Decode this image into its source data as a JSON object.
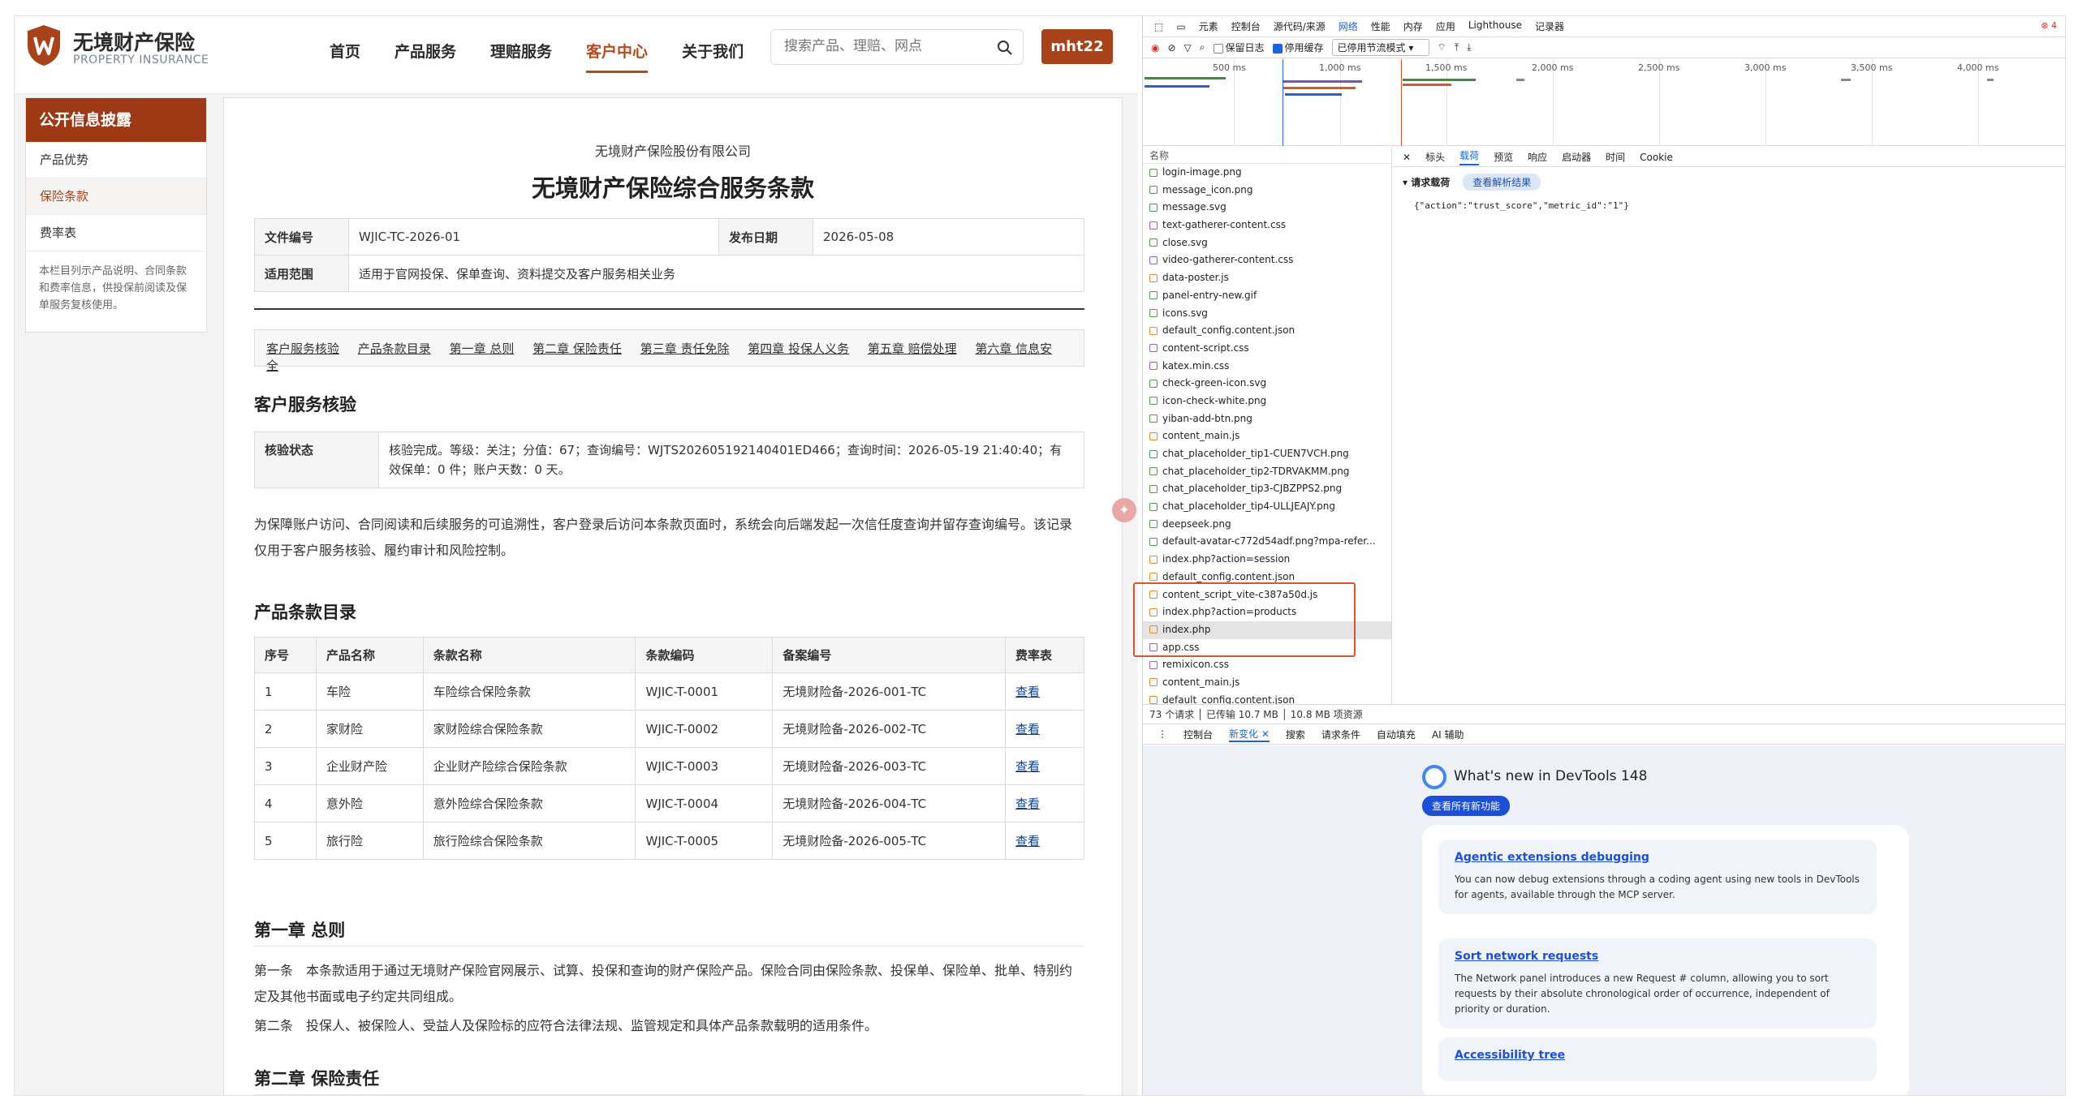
{
  "site": {
    "brand_cn": "无境财产保险",
    "brand_en": "PROPERTY INSURANCE",
    "nav": [
      "首页",
      "产品服务",
      "理赔服务",
      "客户中心",
      "关于我们"
    ],
    "active_nav_index": 3,
    "search_placeholder": "搜索产品、理赔、网点",
    "user_label": "mht22",
    "sidebar": {
      "title": "公开信息披露",
      "items": [
        "产品优势",
        "保险条款",
        "费率表"
      ],
      "active_item_index": 1,
      "note": "本栏目列示产品说明、合同条款和费率信息，供投保前阅读及保单服务复核使用。"
    },
    "doc": {
      "company": "无境财产保险股份有限公司",
      "title": "无境财产保险综合服务条款",
      "meta": {
        "doc_no_label": "文件编号",
        "doc_no": "WJIC-TC-2026-01",
        "date_label": "发布日期",
        "date": "2026-05-08",
        "scope_label": "适用范围",
        "scope": "适用于官网投保、保单查询、资料提交及客户服务相关业务"
      },
      "toc": [
        "客户服务核验",
        "产品条款目录",
        "第一章 总则",
        "第二章 保险责任",
        "第三章 责任免除",
        "第四章 投保人义务",
        "第五章 赔偿处理",
        "第六章 信息安全"
      ],
      "verify_heading": "客户服务核验",
      "verify_label": "核验状态",
      "verify_text": "核验完成。等级：关注；分值：67；查询编号：WJTS202605192140401ED466；查询时间：2026-05-19 21:40:40；有效保单：0 件；账户天数：0 天。",
      "verify_para": "为保障账户访问、合同阅读和后续服务的可追溯性，客户登录后访问本条款页面时，系统会向后端发起一次信任度查询并留存查询编号。该记录仅用于客户服务核验、履约审计和风险控制。",
      "catalog_heading": "产品条款目录",
      "catalog_columns": [
        "序号",
        "产品名称",
        "条款名称",
        "条款编码",
        "备案编号",
        "费率表"
      ],
      "catalog_rows": [
        [
          "1",
          "车险",
          "车险综合保险条款",
          "WJIC-T-0001",
          "无境财险备-2026-001-TC",
          "查看"
        ],
        [
          "2",
          "家财险",
          "家财险综合保险条款",
          "WJIC-T-0002",
          "无境财险备-2026-002-TC",
          "查看"
        ],
        [
          "3",
          "企业财产险",
          "企业财产险综合保险条款",
          "WJIC-T-0003",
          "无境财险备-2026-003-TC",
          "查看"
        ],
        [
          "4",
          "意外险",
          "意外险综合保险条款",
          "WJIC-T-0004",
          "无境财险备-2026-004-TC",
          "查看"
        ],
        [
          "5",
          "旅行险",
          "旅行险综合保险条款",
          "WJIC-T-0005",
          "无境财险备-2026-005-TC",
          "查看"
        ]
      ],
      "ch1_heading": "第一章 总则",
      "ch1_art1": "第一条　本条款适用于通过无境财产保险官网展示、试算、投保和查询的财产保险产品。保险合同由保险条款、投保单、保险单、批单、特别约定及其他书面或电子约定共同组成。",
      "ch1_art2": "第二条　投保人、被保险人、受益人及保险标的应符合法律法规、监管规定和具体产品条款载明的适用条件。",
      "ch2_heading": "第二章 保险责任"
    }
  },
  "devtools": {
    "tabs": [
      "元素",
      "控制台",
      "源代码/来源",
      "网络",
      "性能",
      "内存",
      "应用",
      "Lighthouse",
      "记录器"
    ],
    "active_tab_index": 3,
    "error_count": "4",
    "toolbar": {
      "preserve_log": "保留日志",
      "disable_cache": "停用缓存",
      "throttle": "已停用节流模式"
    },
    "timeline_ticks": [
      "500 ms",
      "1,000 ms",
      "1,500 ms",
      "2,000 ms",
      "2,500 ms",
      "3,000 ms",
      "3,500 ms",
      "4,000 ms"
    ],
    "list_header": "名称",
    "requests": [
      "login-image.png",
      "message_icon.png",
      "message.svg",
      "text-gatherer-content.css",
      "close.svg",
      "video-gatherer-content.css",
      "data-poster.js",
      "panel-entry-new.gif",
      "icons.svg",
      "default_config.content.json",
      "content-script.css",
      "katex.min.css",
      "check-green-icon.svg",
      "icon-check-white.png",
      "yiban-add-btn.png",
      "content_main.js",
      "chat_placeholder_tip1-CUEN7VCH.png",
      "chat_placeholder_tip2-TDRVAKMM.png",
      "chat_placeholder_tip3-CJBZPPS2.png",
      "chat_placeholder_tip4-ULLJEAJY.png",
      "deepseek.png",
      "default-avatar-c772d54adf.png?mpa-refer...",
      "index.php?action=session",
      "default_config.content.json",
      "content_script_vite-c387a50d.js",
      "index.php?action=products",
      "index.php",
      "app.css",
      "remixicon.css",
      "content_main.js",
      "default_config.content.json"
    ],
    "selected_request_index": 26,
    "status": {
      "requests": "73 个请求",
      "transferred": "已传输 10.7 MB",
      "resources": "10.8 MB 项资源"
    },
    "detail_tabs": [
      "标头",
      "载荷",
      "预览",
      "响应",
      "启动器",
      "时间",
      "Cookie"
    ],
    "active_detail_index": 1,
    "payload_heading": "请求载荷",
    "parse_btn": "查看解析结果",
    "payload": "{\"action\":\"trust_score\",\"metric_id\":\"1\"}",
    "drawer_tabs": [
      "控制台",
      "新变化",
      "搜索",
      "请求条件",
      "自动填充",
      "AI 辅助"
    ],
    "active_drawer_index": 1,
    "whatsnew_title": "What's new in DevTools 148",
    "whatsnew_btn": "查看所有新功能",
    "cards": [
      {
        "title": "Agentic extensions debugging",
        "body": "You can now debug extensions through a coding agent using new tools in DevTools for agents, available through the MCP server."
      },
      {
        "title": "Sort network requests",
        "body": "The Network panel introduces a new Request # column, allowing you to sort requests by their absolute chronological order of occurrence, independent of priority or duration."
      },
      {
        "title": "Accessibility tree",
        "body": ""
      }
    ]
  }
}
